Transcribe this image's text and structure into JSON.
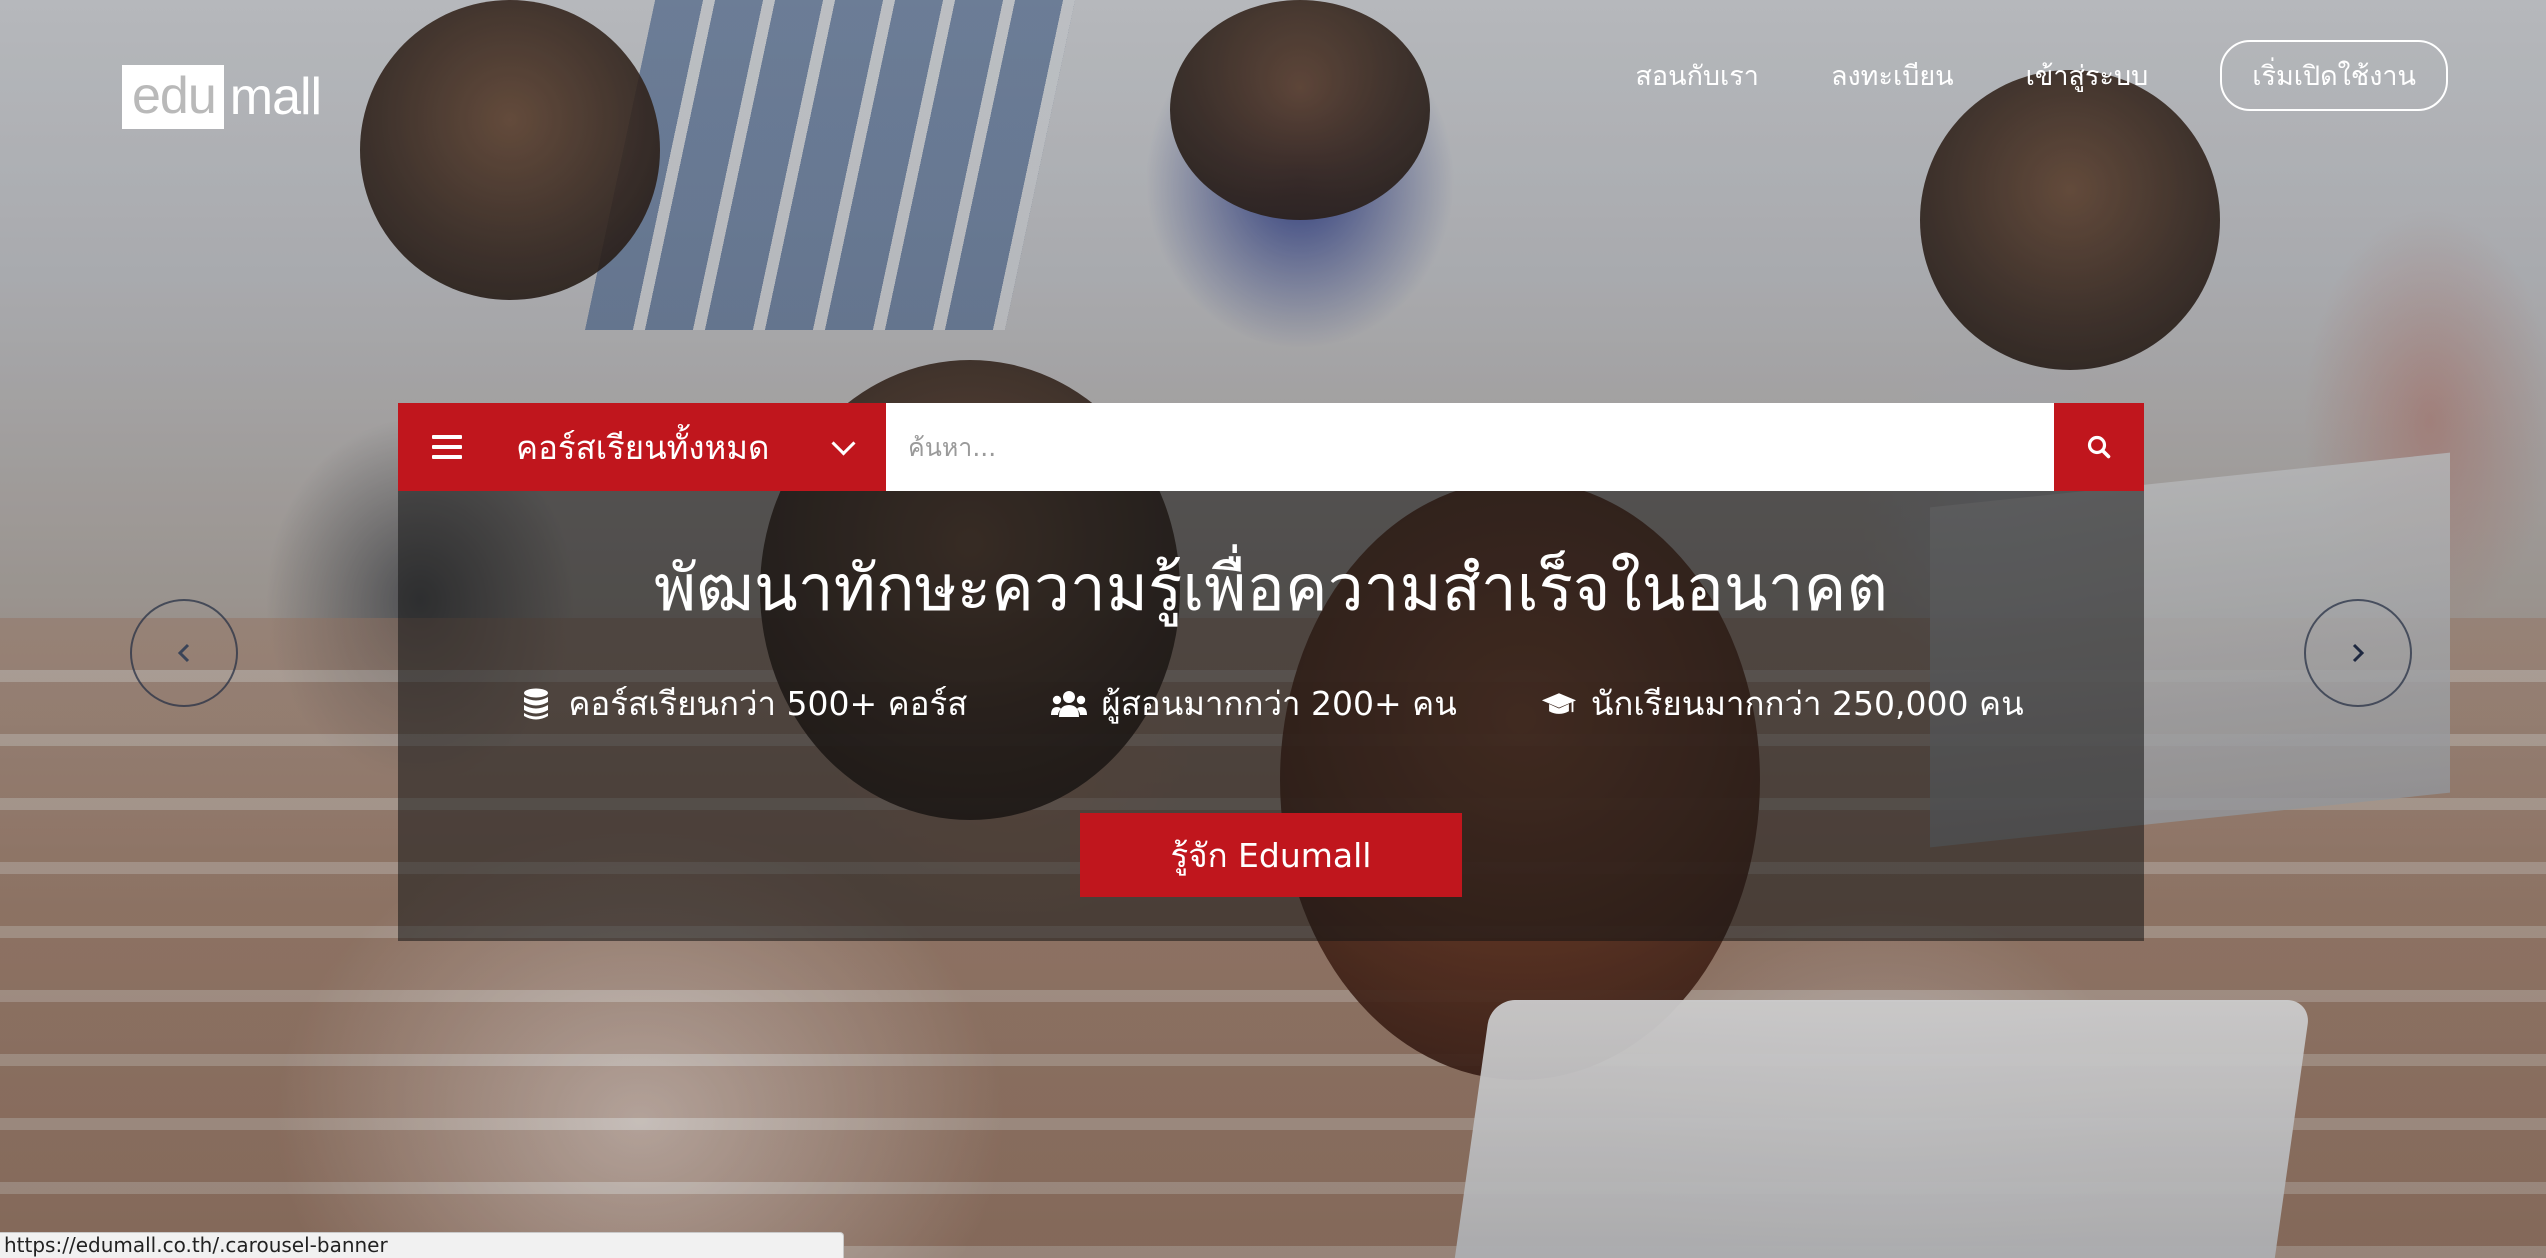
{
  "header": {
    "logo_boxed": "edu",
    "logo_rest": "mall",
    "nav": [
      {
        "label": "สอนกับเรา"
      },
      {
        "label": "ลงทะเบียน"
      },
      {
        "label": "เข้าสู่ระบบ"
      }
    ],
    "cta_label": "เริ่มเปิดใช้งาน"
  },
  "search": {
    "category_label": "คอร์สเรียนทั้งหมด",
    "placeholder": "ค้นหา..."
  },
  "hero": {
    "title": "พัฒนาทักษะความรู้เพื่อความสำเร็จในอนาคต",
    "stats": [
      {
        "icon": "database-icon",
        "label": "คอร์สเรียนกว่า 500+ คอร์ส"
      },
      {
        "icon": "users-icon",
        "label": "ผู้สอนมากกว่า 200+ คน"
      },
      {
        "icon": "graduation-cap-icon",
        "label": "นักเรียนมากกว่า 250,000 คน"
      }
    ],
    "button_label": "รู้จัก Edumall"
  },
  "carousel": {
    "prev_icon": "chevron-left-icon",
    "next_icon": "chevron-right-icon"
  },
  "status_bar": {
    "url": "https://edumall.co.th/.carousel-banner"
  },
  "colors": {
    "brand_red": "#c0161d",
    "panel_overlay": "rgba(20,20,20,0.55)",
    "text_white": "#ffffff"
  }
}
